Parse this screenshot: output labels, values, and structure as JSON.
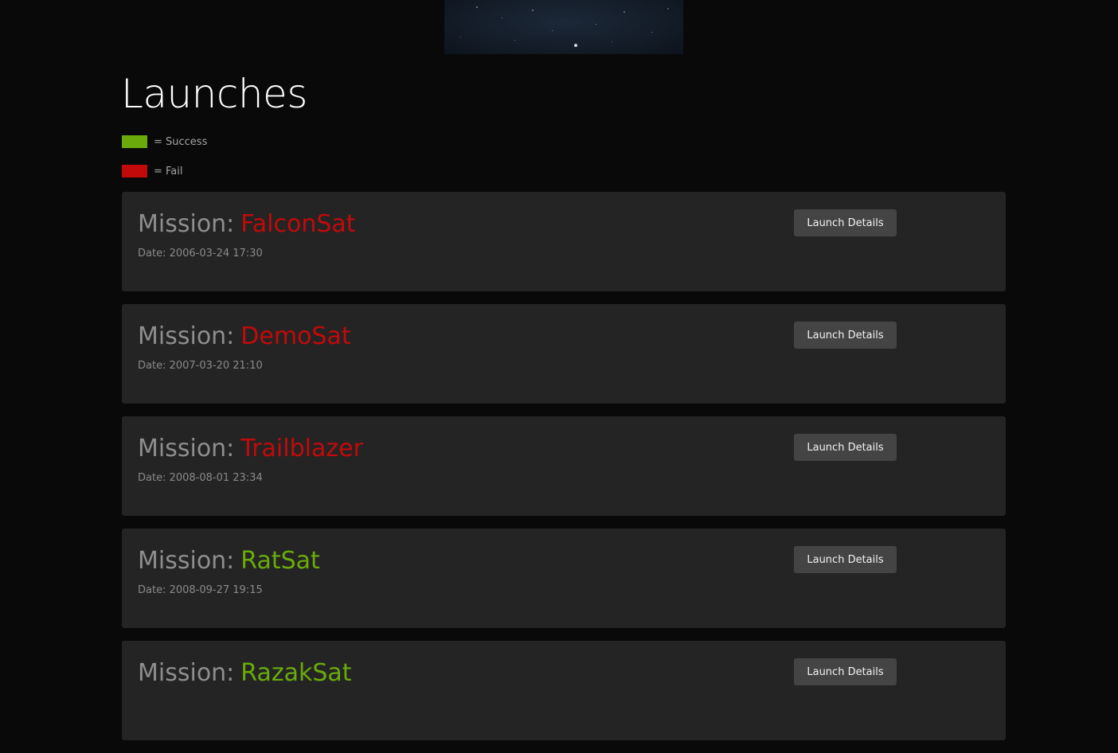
{
  "page": {
    "title": "Launches"
  },
  "legend": [
    {
      "label": "= Success",
      "color": "#6aab0b"
    },
    {
      "label": "= Fail",
      "color": "#c20a0a"
    }
  ],
  "colors": {
    "success": "#6aab0b",
    "fail": "#c20a0a"
  },
  "launches": [
    {
      "prefix": "Mission:",
      "name": "FalconSat",
      "status": "fail",
      "date": "Date: 2006-03-24 17:30",
      "button_label": "Launch Details"
    },
    {
      "prefix": "Mission:",
      "name": "DemoSat",
      "status": "fail",
      "date": "Date: 2007-03-20 21:10",
      "button_label": "Launch Details"
    },
    {
      "prefix": "Mission:",
      "name": "Trailblazer",
      "status": "fail",
      "date": "Date: 2008-08-01 23:34",
      "button_label": "Launch Details"
    },
    {
      "prefix": "Mission:",
      "name": "RatSat",
      "status": "success",
      "date": "Date: 2008-09-27 19:15",
      "button_label": "Launch Details"
    },
    {
      "prefix": "Mission:",
      "name": "RazakSat",
      "status": "success",
      "date": "",
      "button_label": "Launch Details"
    }
  ]
}
